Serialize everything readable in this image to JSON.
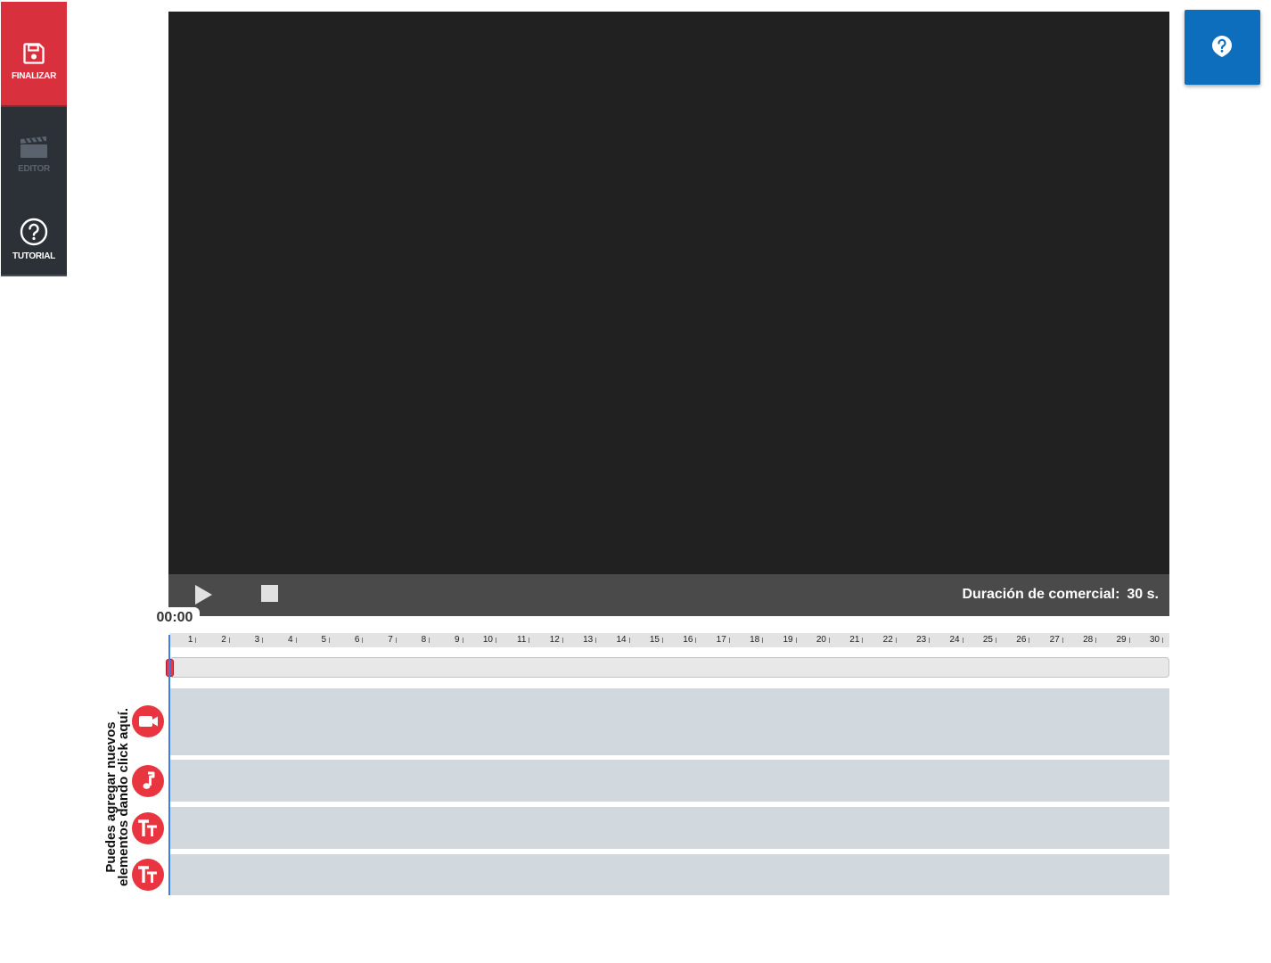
{
  "sidebar": {
    "items": [
      {
        "label": "FINALIZAR",
        "icon": "save-icon",
        "state": "active",
        "color": "#d9303e"
      },
      {
        "label": "EDITOR",
        "icon": "clapperboard-icon",
        "state": "disabled"
      },
      {
        "label": "TUTORIAL",
        "icon": "help-circle-icon",
        "state": "normal"
      }
    ],
    "background": "#2b3137"
  },
  "help_button": {
    "icon": "question-bubble-icon",
    "color": "#0d6ebe"
  },
  "player": {
    "play_icon": "play-icon",
    "stop_icon": "stop-icon",
    "duration_label": "Duración de comercial:",
    "duration_value": "30 s."
  },
  "timeline": {
    "current_time": "00:00",
    "ticks": [
      "1",
      "2",
      "3",
      "4",
      "5",
      "6",
      "7",
      "8",
      "9",
      "10",
      "11",
      "12",
      "13",
      "14",
      "15",
      "16",
      "17",
      "18",
      "19",
      "20",
      "21",
      "22",
      "23",
      "24",
      "25",
      "26",
      "27",
      "28",
      "29",
      "30"
    ],
    "playhead_position_seconds": 0,
    "hint_text": "Puedes agregar nuevos elementos dando click aquí.",
    "tracks": [
      {
        "type": "video",
        "icon": "video-camera-icon"
      },
      {
        "type": "audio",
        "icon": "music-note-icon"
      },
      {
        "type": "text",
        "icon": "text-size-icon"
      },
      {
        "type": "text",
        "icon": "text-size-icon"
      }
    ],
    "accent": "#e8353f",
    "track_color": "#d1d9df"
  }
}
